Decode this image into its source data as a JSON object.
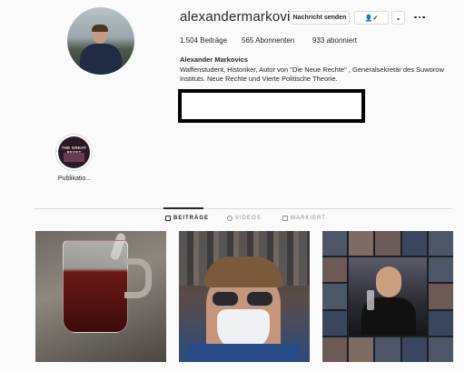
{
  "profile": {
    "username": "alexandermarkovics",
    "buttons": {
      "message": "Nachricht senden",
      "follow": "👤✓",
      "dropdown": "⌄"
    },
    "stats": {
      "posts": "1.504",
      "posts_label": "Beiträge",
      "followers": "565",
      "followers_label": "Abonnenten",
      "following": "933",
      "following_label": "abonniert"
    },
    "full_name": "Alexander Markovics",
    "bio": "Waffenstudent, Historiker, Autor von \"Die Neue Rechte\" , Generalsekretär des Suworow Instituts. Neue Rechte und Vierte Politische Theorie."
  },
  "highlights": [
    {
      "label": "Publikatio...",
      "cover_text": "THE GREAT RESET"
    }
  ],
  "tabs": [
    {
      "label": "BEITRÄGE",
      "icon": "grid-icon",
      "active": true
    },
    {
      "label": "VIDEOS",
      "icon": "video-icon",
      "active": false
    },
    {
      "label": "MARKIERT",
      "icon": "tag-icon",
      "active": false
    }
  ],
  "colors": {
    "background": "#fafafa",
    "text": "#262626",
    "muted": "#8e8e8e",
    "border": "#dbdbdb"
  }
}
